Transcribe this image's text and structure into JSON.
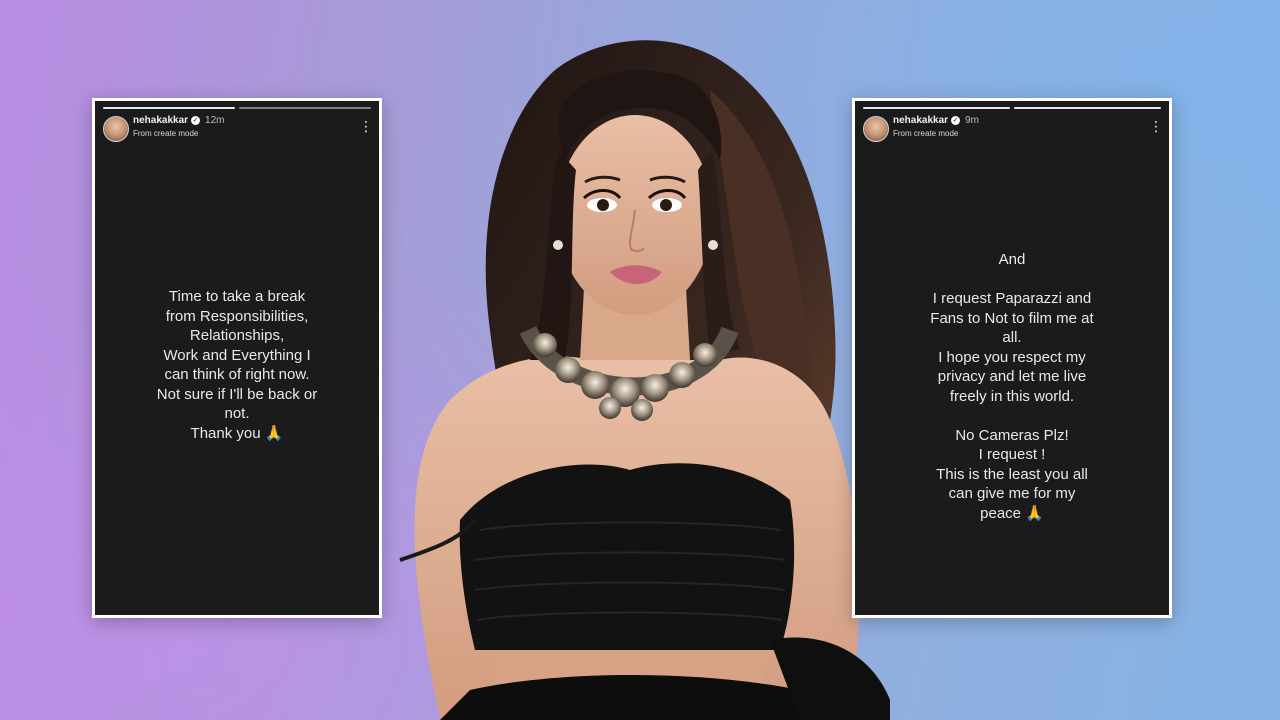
{
  "stories": {
    "left": {
      "username": "nehakakkar",
      "time": "12m",
      "subtext": "From create mode",
      "lines": [
        "Time to take a break",
        "from Responsibilities,",
        "Relationships,",
        "Work and Everything I",
        "can think of right now.",
        "Not sure if I'll be back or",
        "not.",
        "Thank you 🙏"
      ]
    },
    "right": {
      "username": "nehakakkar",
      "time": "9m",
      "subtext": "From create mode",
      "lines": [
        "And",
        "",
        "I request Paparazzi and",
        "Fans to Not to film me at",
        "all.",
        "I hope you respect my",
        "privacy and let me live",
        "freely in this world.",
        "",
        "No Cameras Plz!",
        "I request !",
        "This is the least you all",
        "can give me for my",
        "peace 🙏"
      ]
    }
  },
  "colors": {
    "card_bg": "#1b1b1b",
    "card_border": "#ffffff",
    "background_left": "#b98ce3",
    "background_right": "#85b3e6",
    "dress": "#111111",
    "hair": "#2a1c18"
  },
  "icons": {
    "verified": "verified-badge-icon",
    "menu": "more-vertical-icon"
  }
}
